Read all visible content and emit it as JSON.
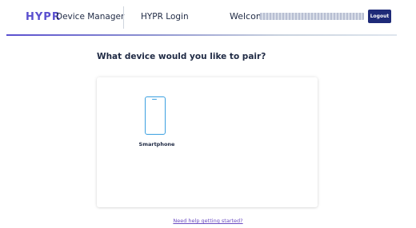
{
  "header": {
    "logo": "HYPR",
    "app_name": "Device Manager",
    "nav_login": "HYPR Login",
    "welcome": "Welcome,",
    "logout": "Logout"
  },
  "main": {
    "question": "What device would you like to pair?",
    "devices": [
      {
        "label": "Smartphone",
        "icon": "smartphone-icon"
      }
    ],
    "help_link": "Need help getting started?"
  },
  "colors": {
    "brand": "#5a4fcf",
    "logout_bg": "#1e2a78",
    "icon_stroke": "#3ba0e0",
    "link": "#6b4bc2",
    "text": "#1f2a44"
  }
}
